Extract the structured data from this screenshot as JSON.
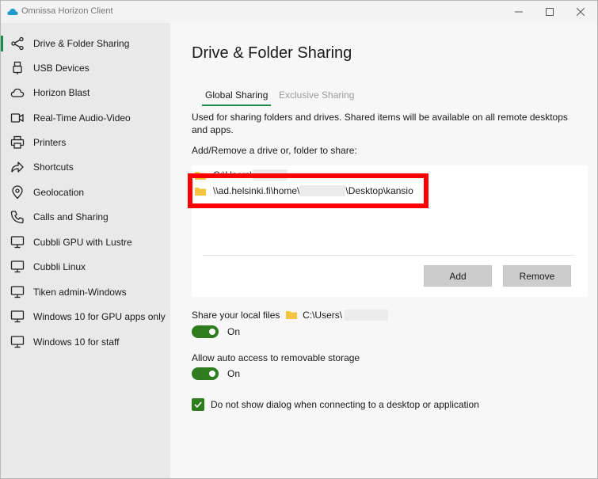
{
  "window": {
    "title": "Omnissa Horizon Client",
    "controls": {
      "minimize": "—",
      "maximize": "☐",
      "close": "✕"
    }
  },
  "sidebar": {
    "items": [
      {
        "label": "Drive & Folder Sharing",
        "icon": "share-icon",
        "active": true
      },
      {
        "label": "USB Devices",
        "icon": "usb-icon"
      },
      {
        "label": "Horizon Blast",
        "icon": "cloud-icon"
      },
      {
        "label": "Real-Time Audio-Video",
        "icon": "video-camera-icon"
      },
      {
        "label": "Printers",
        "icon": "printer-icon"
      },
      {
        "label": "Shortcuts",
        "icon": "shortcut-arrow-icon"
      },
      {
        "label": "Geolocation",
        "icon": "location-pin-icon"
      },
      {
        "label": "Calls and Sharing",
        "icon": "phone-icon"
      },
      {
        "label": "Cubbli GPU with Lustre",
        "icon": "monitor-icon"
      },
      {
        "label": "Cubbli Linux",
        "icon": "monitor-icon"
      },
      {
        "label": "Tiken admin-Windows",
        "icon": "monitor-icon"
      },
      {
        "label": "Windows 10 for GPU apps only",
        "icon": "monitor-icon"
      },
      {
        "label": "Windows 10 for staff",
        "icon": "monitor-icon"
      }
    ]
  },
  "main": {
    "title": "Drive & Folder Sharing",
    "tabs": [
      {
        "label": "Global Sharing",
        "selected": true
      },
      {
        "label": "Exclusive Sharing",
        "selected": false
      }
    ],
    "description": "Used for sharing folders and drives. Shared items will be available on all remote desktops and apps.",
    "add_remove_label": "Add/Remove a drive or, folder to share:",
    "shared_items": [
      {
        "path_visible_prefix": "C:\\Users\\",
        "path_suffix": ""
      },
      {
        "path_visible_prefix": "\\\\ad.helsinki.fi\\home\\",
        "path_suffix": "\\Desktop\\kansio"
      }
    ],
    "buttons": {
      "add": "Add",
      "remove": "Remove"
    },
    "share_local_files": {
      "label": "Share your local files",
      "path": "C:\\Users\\",
      "state": "On"
    },
    "auto_access": {
      "label": "Allow auto access to removable storage",
      "state": "On"
    },
    "no_dialog": {
      "label": "Do not show dialog when connecting to a desktop or application",
      "checked": true
    }
  },
  "colors": {
    "accent": "#1b8a4b",
    "toggle_on": "#2d7d1e",
    "highlight": "#ff0000",
    "sidebar_bg": "#e9e9e9",
    "folder": "#f5c542"
  }
}
